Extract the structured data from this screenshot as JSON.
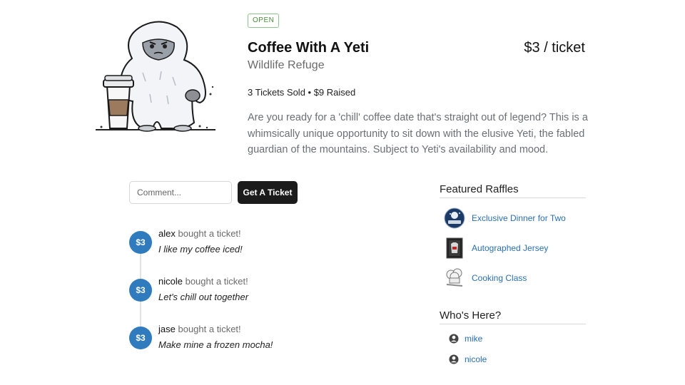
{
  "status_badge": "OPEN",
  "raffle": {
    "title": "Coffee With A Yeti",
    "price": "$3 / ticket",
    "subtitle": "Wildlife Refuge",
    "stats": "3 Tickets Sold • $9 Raised",
    "description": "Are you ready for a 'chill' coffee date that's straight out of legend? This is a whimsically unique opportunity to sit down with the elusive Yeti, the fabled guardian of the mountains. Subject to Yeti's availability and mood."
  },
  "comment": {
    "placeholder": "Comment...",
    "value": ""
  },
  "buttons": {
    "get_ticket": "Get A Ticket"
  },
  "activity": [
    {
      "amount": "$3",
      "user": "alex",
      "action": "bought a ticket!",
      "comment": "I like my coffee iced!"
    },
    {
      "amount": "$3",
      "user": "nicole",
      "action": "bought a ticket!",
      "comment": "Let's chill out together"
    },
    {
      "amount": "$3",
      "user": "jase",
      "action": "bought a ticket!",
      "comment": "Make mine a frozen mocha!"
    }
  ],
  "sidebar": {
    "featured_title": "Featured Raffles",
    "featured": [
      {
        "label": "Exclusive Dinner for Two",
        "icon": "dinner-thumbnail"
      },
      {
        "label": "Autographed Jersey",
        "icon": "jersey-thumbnail"
      },
      {
        "label": "Cooking Class",
        "icon": "chef-hat-thumbnail"
      }
    ],
    "whos_here_title": "Who's Here?",
    "users": [
      {
        "name": "mike",
        "icon": "user-icon"
      },
      {
        "name": "nicole",
        "icon": "user-icon"
      }
    ]
  },
  "colors": {
    "badge_green": "#4a8f3c",
    "avatar_blue": "#2f7bbd",
    "link_blue": "#2a6fb0",
    "button_dark": "#1b1b1b"
  }
}
